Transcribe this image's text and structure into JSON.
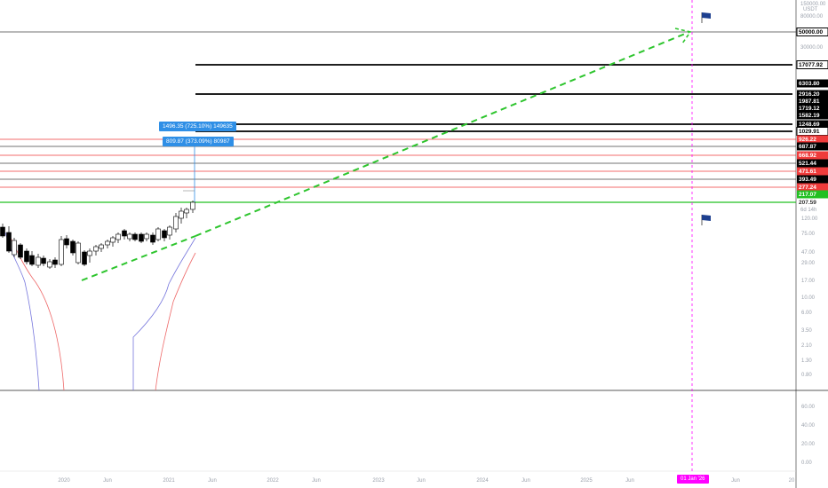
{
  "chart_data": {
    "type": "candlestick",
    "title": "",
    "currency_label": "USDT",
    "price_scale": "log",
    "grid": false,
    "x_ticks": [
      "2020",
      "Jun",
      "2021",
      "Jun",
      "2022",
      "Jun",
      "2023",
      "Jun",
      "2024",
      "Jun",
      "2025",
      "Jun",
      "Jun",
      "20"
    ],
    "highlighted_date": "01 Jan '26",
    "main_axis_ticks": [
      "150000.00",
      "80000.00",
      "30000.00"
    ],
    "lower_axis_ticks": [
      "120.00",
      "75.00",
      "47.00",
      "29.00",
      "17.00",
      "10.00",
      "6.00",
      "3.50",
      "2.10",
      "1.30",
      "0.80"
    ],
    "indicator_axis_ticks": [
      "60.00",
      "40.00",
      "20.00",
      "0.00"
    ],
    "countdown": "6d 14h",
    "levels": [
      {
        "label": "50000.00",
        "color": "#000000",
        "line": "thin"
      },
      {
        "label": "17077.92",
        "color": "#000000",
        "line": "thick"
      },
      {
        "label": "6303.80",
        "color": "#000000",
        "line": "none"
      },
      {
        "label": "2916.20",
        "color": "#000000",
        "line": "thick"
      },
      {
        "label": "1987.81",
        "color": "#000000",
        "line": "none"
      },
      {
        "label": "1719.12",
        "color": "#000000",
        "line": "none"
      },
      {
        "label": "1582.19",
        "color": "#000000",
        "line": "none"
      },
      {
        "label": "1248.69",
        "color": "#000000",
        "line": "thick"
      },
      {
        "label": "1029.91",
        "color": "#000000",
        "line": "thick"
      },
      {
        "label": "926.22",
        "color": "#ef3b3b",
        "line": "thin"
      },
      {
        "label": "687.87",
        "color": "#000000",
        "line": "thin"
      },
      {
        "label": "668.92",
        "color": "#ef3b3b",
        "line": "thin"
      },
      {
        "label": "521.44",
        "color": "#000000",
        "line": "thin"
      },
      {
        "label": "471.61",
        "color": "#ef3b3b",
        "line": "thin"
      },
      {
        "label": "393.49",
        "color": "#000000",
        "line": "thin"
      },
      {
        "label": "277.24",
        "color": "#ef3b3b",
        "line": "thin"
      },
      {
        "label": "217.07",
        "color": "#21c021",
        "line": "green"
      },
      {
        "label": "207.59",
        "color": "#ffffff",
        "line": "none"
      }
    ],
    "measure_labels": [
      "1496.35 (725.10%) 149635",
      "809.87 (373.09%) 80987"
    ],
    "colors": {
      "up": "#ffffff",
      "down": "#000000",
      "projection": "#2ec52e",
      "support": "#21c021",
      "resistance": "#ef3b3b",
      "flag": "#1d3f8f",
      "highlight": "#ff00ff",
      "measure": "#2f8fe6",
      "band_outer": "#7777dd",
      "band_inner": "#ee6a6a"
    }
  }
}
